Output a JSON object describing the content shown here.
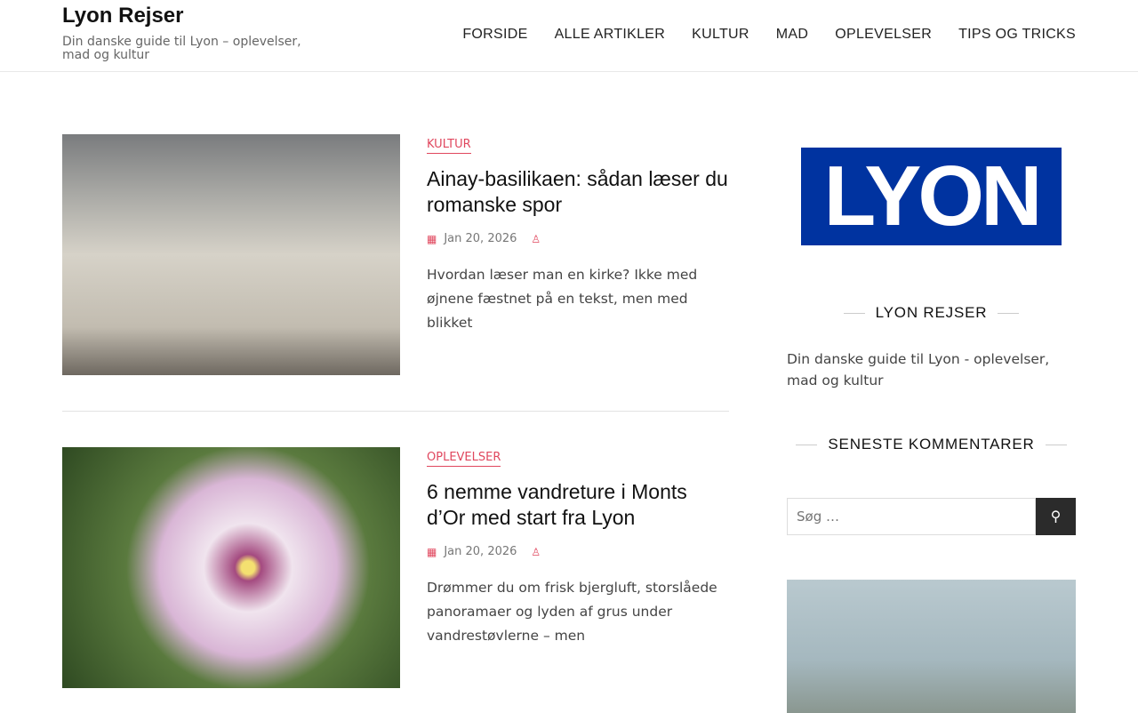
{
  "site": {
    "title": "Lyon Rejser",
    "tagline": "Din danske guide til Lyon – oplevelser, mad og kultur"
  },
  "nav": [
    "FORSIDE",
    "ALLE ARTIKLER",
    "KULTUR",
    "MAD",
    "OPLEVELSER",
    "TIPS OG TRICKS"
  ],
  "posts": [
    {
      "category": "KULTUR",
      "title": "Ainay-basilikaen: sådan læser du romanske spor",
      "date": "Jan 20, 2026",
      "excerpt": "Hvordan læser man en kirke? Ikke med øjnene fæstnet på en tekst, men med blikket"
    },
    {
      "category": "OPLEVELSER",
      "title": "6 nemme vandreture i Monts d’Or med start fra Lyon",
      "date": "Jan 20, 2026",
      "excerpt": "Drømmer du om frisk bjergluft, storslåede panoramaer og lyden af grus under vandrestøvlerne – men"
    }
  ],
  "sidebar": {
    "logo_text": "LYON",
    "about_title": "LYON REJSER",
    "about_text": "Din danske guide til Lyon - oplevelser, mad og kultur",
    "comments_title": "SENESTE KOMMENTARER",
    "search_placeholder": "Søg …"
  }
}
